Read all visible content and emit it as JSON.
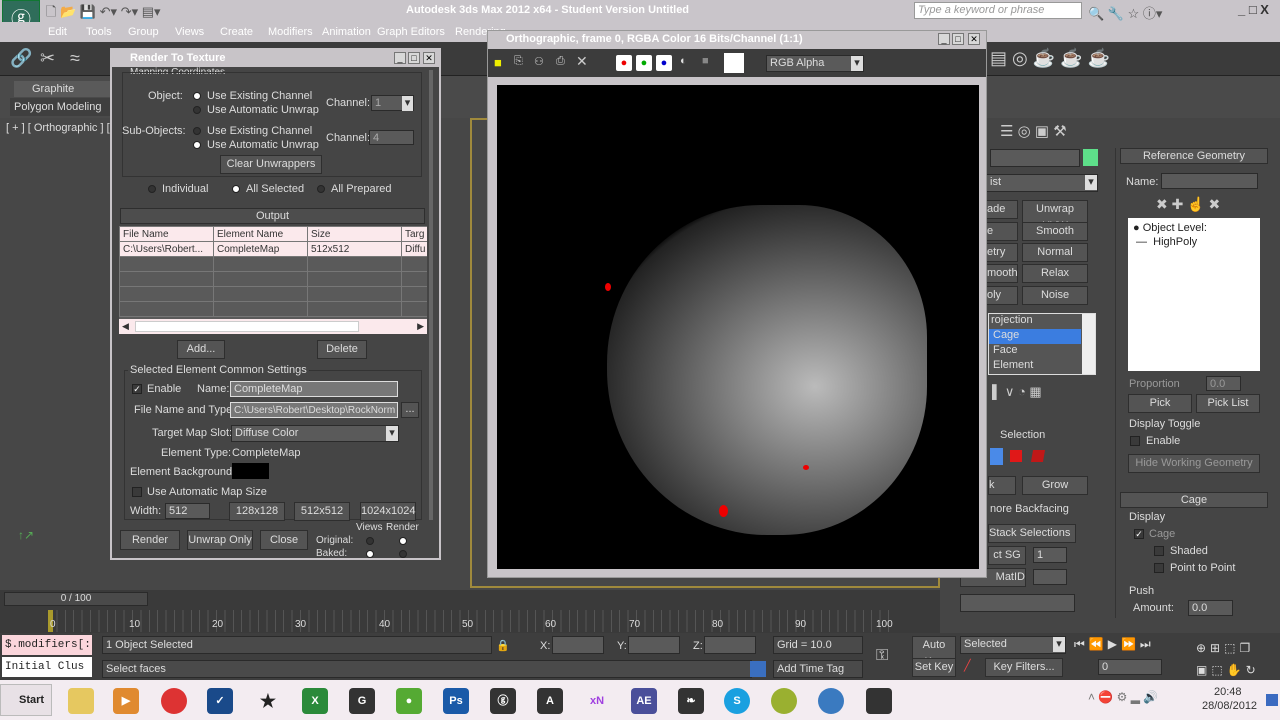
{
  "app": {
    "title": "Autodesk 3ds Max  2012 x64  - Student Version   Untitled",
    "search_placeholder": "Type a keyword or phrase"
  },
  "menu": [
    "Edit",
    "Tools",
    "Group",
    "Views",
    "Create",
    "Modifiers",
    "Animation",
    "Graph Editors",
    "Rendering"
  ],
  "ribbon": {
    "tab": "Graphite Modeling",
    "subtab": "Polygon Modeling",
    "viewport_label": "[ + ] [ Orthographic ] [ S"
  },
  "rtt": {
    "title": "Render To Texture",
    "section_cut": "Mapping Coordinates",
    "object_label": "Object:",
    "subobjects_label": "Sub-Objects:",
    "opt_existing": "Use Existing Channel",
    "opt_auto": "Use Automatic Unwrap",
    "channel_label": "Channel:",
    "channel1": "1",
    "channel2": "4",
    "clear_unwrappers": "Clear Unwrappers",
    "individual": "Individual",
    "all_selected": "All Selected",
    "all_prepared": "All Prepared",
    "output_title": "Output",
    "columns": [
      "File Name",
      "Element Name",
      "Size",
      "Targ"
    ],
    "rows": [
      [
        "C:\\Users\\Robert...",
        "CompleteMap",
        "512x512",
        "Diffu"
      ]
    ],
    "add": "Add...",
    "delete": "Delete",
    "common_title": "Selected Element Common Settings",
    "enable": "Enable",
    "name_label": "Name:",
    "name_value": "CompleteMap",
    "file_label": "File Name and Type:",
    "file_value": "C:\\Users\\Robert\\Desktop\\RockNorm",
    "browse": "...",
    "slot_label": "Target Map Slot:",
    "slot_value": "Diffuse Color",
    "type_label": "Element Type:",
    "type_value": "CompleteMap",
    "bg_label": "Element Background:",
    "auto_size": "Use Automatic Map Size",
    "width_label": "Width:",
    "width_value": "512",
    "presets": [
      "128x128",
      "512x512",
      "1024x1024"
    ],
    "render": "Render",
    "unwrap_only": "Unwrap Only",
    "close": "Close",
    "views": "Views",
    "render_col": "Render",
    "original": "Original:",
    "baked": "Baked:"
  },
  "frame": {
    "title": "Orthographic, frame 0, RGBA Color 16 Bits/Channel (1:1)",
    "channel_select": "RGB Alpha"
  },
  "cmd": {
    "list_suffix": "ist",
    "mods": [
      [
        "ade",
        "Unwrap UVW"
      ],
      [
        "e",
        "Smooth"
      ],
      [
        "etry",
        "Normal"
      ],
      [
        "mooth",
        "Relax"
      ],
      [
        "oly",
        "Noise"
      ]
    ],
    "list": [
      "rojection",
      "Cage",
      "Face",
      "Element"
    ],
    "selection": "Selection",
    "k": "k",
    "grow": "Grow",
    "ignore_backfacing": "nore Backfacing",
    "stack_selections": "Stack Selections",
    "sg": "ct SG",
    "sg_value": "1",
    "matid": "MatID",
    "ref_title": "Reference Geometry",
    "name_label": "Name:",
    "obj_level": "Object Level:",
    "highpoly": "HighPoly",
    "proportion": "Proportion",
    "proportion_value": "0.0",
    "pick": "Pick",
    "pick_list": "Pick List",
    "display_toggle": "Display Toggle",
    "enable": "Enable",
    "hide_working": "Hide Working Geometry",
    "cage_title": "Cage",
    "display": "Display",
    "cage": "Cage",
    "shaded": "Shaded",
    "point_to_point": "Point to Point",
    "push": "Push",
    "amount_label": "Amount:",
    "amount_value": "0.0"
  },
  "timeline": {
    "frame": "0 / 100",
    "ticks": [
      "0",
      "10",
      "20",
      "30",
      "40",
      "50",
      "60",
      "70",
      "80",
      "90",
      "100"
    ]
  },
  "status": {
    "script1": "$.modifiers[:",
    "script2": "Initial Clus",
    "selected": "1 Object Selected",
    "prompt": "Select faces",
    "x": "X:",
    "y": "Y:",
    "z": "Z:",
    "grid": "Grid = 10.0",
    "add_time_tag": "Add Time Tag",
    "auto_key": "Auto Key",
    "set_key": "Set Key",
    "key_mode": "Selected",
    "key_filters": "Key Filters...",
    "frame_value": "0"
  },
  "taskbar": {
    "start": "Start",
    "time": "20:48",
    "date": "28/08/2012",
    "apps": [
      "Ps",
      "xN",
      "AE"
    ]
  }
}
